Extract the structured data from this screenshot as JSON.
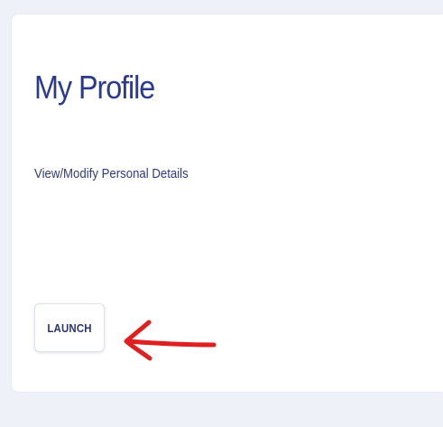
{
  "card": {
    "title": "My Profile",
    "description": "View/Modify Personal Details",
    "launch_label": "LAUNCH"
  },
  "icons": {
    "annotation": "red-arrow-icon"
  },
  "colors": {
    "page_background": "#eef1f8",
    "card_background": "#ffffff",
    "title_text": "#2b3a8f",
    "description_text": "#2e3a82",
    "button_text": "#2a3577",
    "annotation_arrow": "#e02020"
  }
}
